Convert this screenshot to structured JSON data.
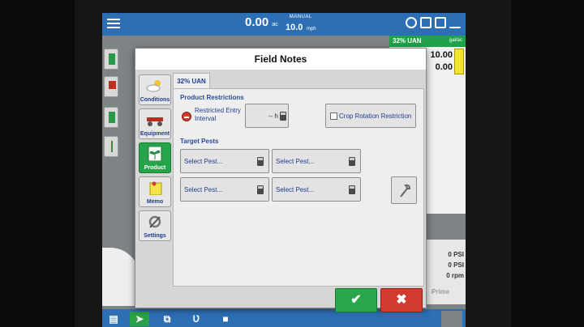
{
  "topbar": {
    "speed_value": "0.00",
    "speed_unit": "ac",
    "mode_label": "MANUAL",
    "manual_speed_value": "10.0",
    "manual_speed_unit": "mph"
  },
  "rate_panel": {
    "product": "32% UAN",
    "unit": "gal/ac",
    "target_rate": "10.00",
    "actual_rate": "0.00"
  },
  "pressure": {
    "readings": [
      "0 PSI",
      "0 PSI",
      "0 rpm"
    ],
    "prime_label": "Prime"
  },
  "dialog": {
    "title": "Field Notes",
    "side_buttons": [
      {
        "label": "Conditions",
        "icon": "cloud-sun-icon"
      },
      {
        "label": "Equipment",
        "icon": "planter-icon"
      },
      {
        "label": "Product",
        "icon": "seedling-icon"
      },
      {
        "label": "Memo",
        "icon": "pin-note-icon"
      },
      {
        "label": "Settings",
        "icon": "gear-wrench-icon"
      }
    ],
    "active_side": "Product",
    "tab_label": "32% UAN",
    "product_restrictions_label": "Product Restrictions",
    "rei_label": "Restricted Entry Interval",
    "rei_value": "-- h",
    "crop_rotation_label": "Crop Rotation Restriction",
    "target_pests_label": "Target Pests",
    "pest_placeholders": [
      "Select Pest...",
      "Select Pest...",
      "Select Pest...",
      "Select Pest..."
    ],
    "ok_symbol": "✔",
    "cancel_symbol": "✖"
  },
  "colors": {
    "topbar_blue": "#2c6fb5",
    "accent_green": "#27a34a",
    "cancel_red": "#d33b30",
    "label_blue": "#1c3d8f"
  }
}
